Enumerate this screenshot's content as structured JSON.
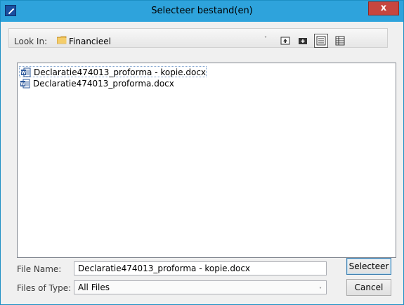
{
  "window": {
    "title": "Selecteer bestand(en)",
    "close_label": "x"
  },
  "toolbar": {
    "look_in_label": "Look In:",
    "folder": "Financieel",
    "dropdown_arrow": "˅",
    "buttons": [
      "up-one-level-icon",
      "new-folder-icon",
      "list-view-icon",
      "details-view-icon"
    ]
  },
  "files": [
    {
      "name": "Declaratie474013_proforma - kopie.docx",
      "selected": true
    },
    {
      "name": "Declaratie474013_proforma.docx",
      "selected": false
    }
  ],
  "form": {
    "file_name_label": "File Name:",
    "file_name_value": "Declaratie474013_proforma - kopie.docx",
    "files_of_type_label": "Files of Type:",
    "files_of_type_value": "All Files"
  },
  "actions": {
    "select_label": "Selecteer",
    "cancel_label": "Cancel"
  },
  "colors": {
    "titlebar": "#2ea3dc",
    "close": "#c7463f"
  }
}
